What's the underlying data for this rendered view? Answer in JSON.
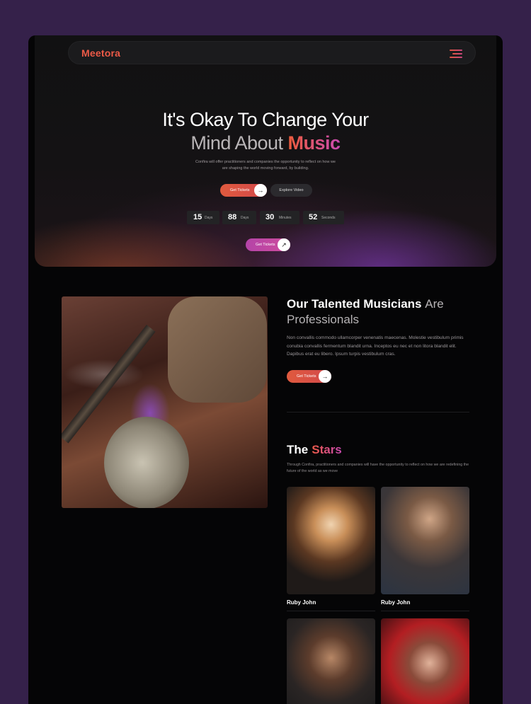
{
  "nav": {
    "logo": "Meetora",
    "menu_icon": "hamburger-menu-icon"
  },
  "hero": {
    "title_line1": "It's Okay To Change Your",
    "title_line2_prefix": "Mind About",
    "title_line2_accent": "Music",
    "description": "Confira will offer practitioners and companies the opportunity to reflect on how we are shaping the world moving forward, by building.",
    "primary_button": "Get Tickets",
    "secondary_button": "Explore Video",
    "countdown": [
      {
        "value": "15",
        "unit": "Days"
      },
      {
        "value": "88",
        "unit": "Days"
      },
      {
        "value": "30",
        "unit": "Minutes"
      },
      {
        "value": "52",
        "unit": "Seconds"
      }
    ],
    "bottom_button": "Get Tickets"
  },
  "musicians": {
    "title_main": "Our Talented Musicians",
    "title_dim": "Are",
    "title_line2": "Professionals",
    "description": "Non convallis commodo ullamcorper venenatis maecenas. Molestie vestibulum primis conubia convallis fermentum blandit urna. Inceptos eu nec et non litora blandit elit. Dapibus erat eu libero. Ipsum turpis vestibulum cras.",
    "button": "Get Tickets"
  },
  "stars": {
    "title_main": "The",
    "title_accent": "Stars",
    "description": "Through Confira, practitioners and companies will have the opportunity to reflect on how we are redefining the future of the world as we move",
    "cards": [
      {
        "name": "Ruby John"
      },
      {
        "name": "Ruby John"
      }
    ]
  },
  "colors": {
    "accent": "#ec5a47",
    "accent_pink": "#c94ab3",
    "background": "#35214a"
  }
}
